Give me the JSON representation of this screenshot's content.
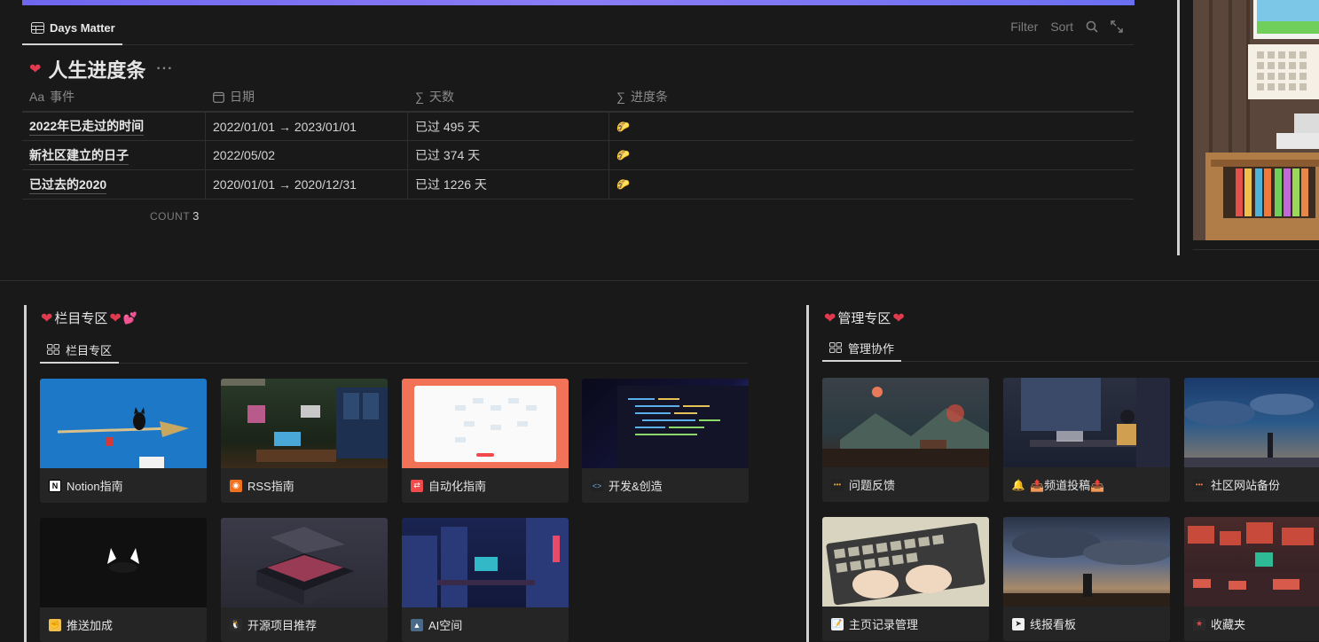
{
  "view_bar": {
    "tab_label": "Days Matter",
    "filter": "Filter",
    "sort": "Sort"
  },
  "database": {
    "title": "人生进度条",
    "more": "···",
    "columns": [
      {
        "label": "事件",
        "icon": "Aa"
      },
      {
        "label": "日期",
        "icon": "calendar-icon"
      },
      {
        "label": "天数",
        "icon": "∑"
      },
      {
        "label": "进度条",
        "icon": "∑"
      }
    ],
    "rows": [
      {
        "name": "2022年已走过的时间",
        "date": "2022/01/01 → 2023/01/01",
        "days": "已过 495 天",
        "progress": "🌮"
      },
      {
        "name": "新社区建立的日子",
        "date": "2022/05/02",
        "days": "已过 374 天",
        "progress": "🌮"
      },
      {
        "name": "已过去的2020",
        "date": "2020/01/01 → 2020/12/31",
        "days": "已过 1226 天",
        "progress": "🌮"
      }
    ],
    "count_label": "COUNT",
    "count_value": "3"
  },
  "section_left": {
    "title": "栏目专区",
    "title_hearts": "❤️",
    "title_end": "💕",
    "tab_label": "栏目专区",
    "cards": [
      {
        "label": "Notion指南",
        "icon": "notion-icon"
      },
      {
        "label": "RSS指南",
        "icon": "rss-icon"
      },
      {
        "label": "自动化指南",
        "icon": "automation-icon"
      },
      {
        "label": "开发&创造",
        "icon": "code-icon"
      },
      {
        "label": "推送加成",
        "icon": "push-icon"
      },
      {
        "label": "开源项目推荐",
        "icon": "opensource-icon"
      },
      {
        "label": "AI空间",
        "icon": "ai-icon"
      }
    ]
  },
  "section_right": {
    "title": "管理专区",
    "tab_label": "管理协作",
    "cards": [
      {
        "label": "问题反馈",
        "icon": "feedback-icon"
      },
      {
        "label": "📤频道投稿📤",
        "icon": "bell-icon"
      },
      {
        "label": "社区网站备份",
        "icon": "backup-icon"
      },
      {
        "label": "主页记录管理",
        "icon": "memo-icon"
      },
      {
        "label": "线报看板",
        "icon": "telegram-icon"
      },
      {
        "label": "收藏夹",
        "icon": "bookmark-icon"
      }
    ]
  },
  "colors": {
    "accent_bar": "#7a6ff0",
    "heart": "#e03a4e",
    "background": "#191919"
  }
}
